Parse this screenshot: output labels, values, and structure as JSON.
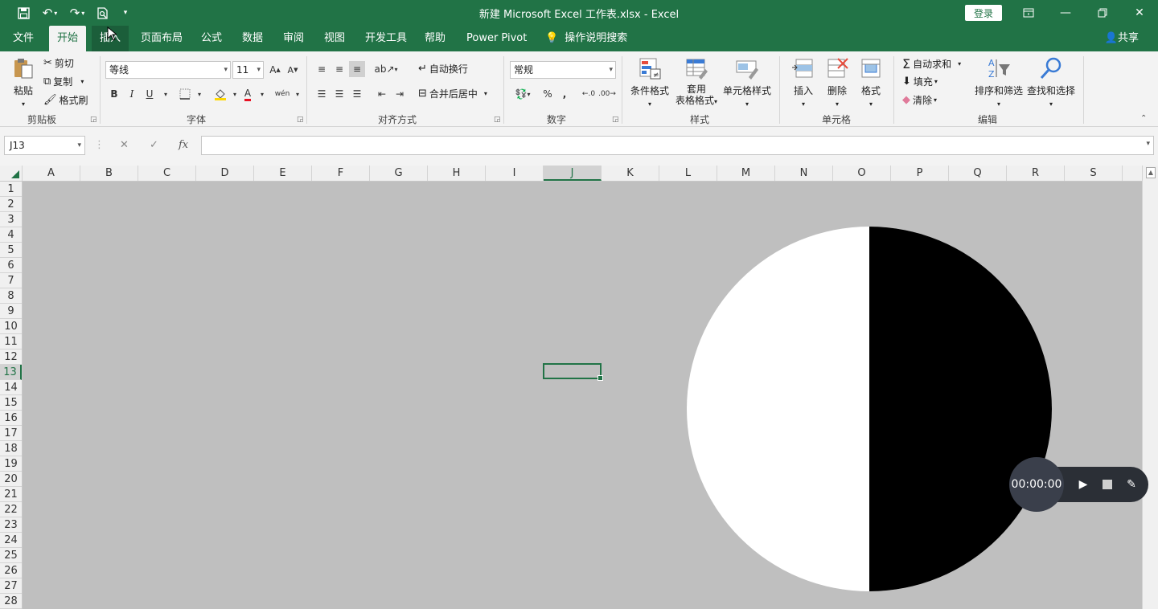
{
  "window": {
    "title": "新建 Microsoft Excel 工作表.xlsx  -  Excel",
    "login_label": "登录"
  },
  "tabs": [
    {
      "label": "文件",
      "active": false
    },
    {
      "label": "开始",
      "active": true
    },
    {
      "label": "插入",
      "active": false
    },
    {
      "label": "页面布局",
      "active": false
    },
    {
      "label": "公式",
      "active": false
    },
    {
      "label": "数据",
      "active": false
    },
    {
      "label": "审阅",
      "active": false
    },
    {
      "label": "视图",
      "active": false
    },
    {
      "label": "开发工具",
      "active": false
    },
    {
      "label": "帮助",
      "active": false
    },
    {
      "label": "Power Pivot",
      "active": false
    }
  ],
  "tell_me": "操作说明搜索",
  "share_label": "共享",
  "ribbon": {
    "clipboard": {
      "paste": "粘贴",
      "cut": "剪切",
      "copy": "复制",
      "format_painter": "格式刷",
      "group": "剪贴板"
    },
    "font": {
      "name": "等线",
      "size": "11",
      "bold": "B",
      "italic": "I",
      "underline": "U",
      "grow": "A",
      "shrink": "A",
      "font_color": "A",
      "phonetic": "wén",
      "group": "字体"
    },
    "alignment": {
      "wrap_text": "自动换行",
      "merge_center": "合并后居中",
      "group": "对齐方式"
    },
    "number": {
      "format": "常规",
      "percent": "%",
      "comma": ",",
      "group": "数字"
    },
    "styles": {
      "conditional": "条件格式",
      "table_line1": "套用",
      "table_line2": "表格格式",
      "cell_styles": "单元格样式",
      "group": "样式"
    },
    "cells": {
      "insert": "插入",
      "delete": "删除",
      "format": "格式",
      "group": "单元格"
    },
    "editing": {
      "autosum": "自动求和",
      "fill": "填充",
      "clear": "清除",
      "sort_filter": "排序和筛选",
      "find_select": "查找和选择",
      "group": "编辑"
    }
  },
  "formula_bar": {
    "name_box": "J13",
    "cancel": "✕",
    "enter": "✓",
    "fx": "fx",
    "value": ""
  },
  "columns": [
    "A",
    "B",
    "C",
    "D",
    "E",
    "F",
    "G",
    "H",
    "I",
    "J",
    "K",
    "L",
    "M",
    "N",
    "O",
    "P",
    "Q",
    "R",
    "S"
  ],
  "rows": [
    "1",
    "2",
    "3",
    "4",
    "5",
    "6",
    "7",
    "8",
    "9",
    "10",
    "11",
    "12",
    "13",
    "14",
    "15",
    "16",
    "17",
    "18",
    "19",
    "20",
    "21",
    "22",
    "23",
    "24",
    "25",
    "26",
    "27",
    "28"
  ],
  "selected": {
    "column": "J",
    "row": "13"
  },
  "recorder": {
    "time": "00:00:00"
  }
}
